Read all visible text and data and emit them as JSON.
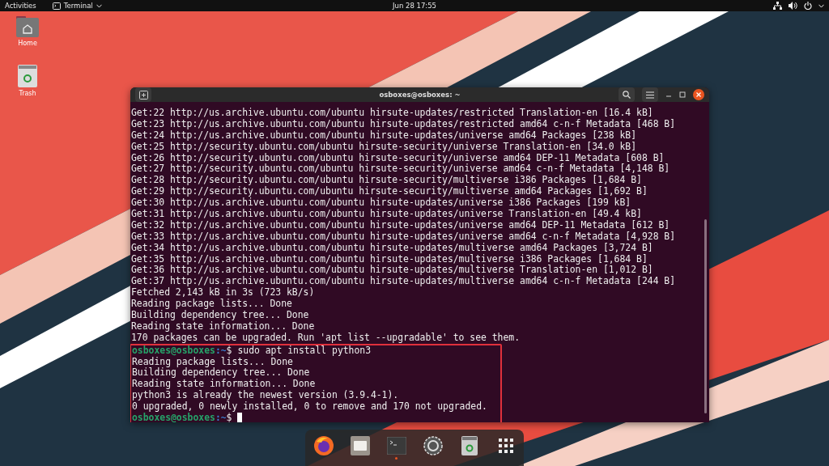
{
  "top_bar": {
    "activities": "Activities",
    "app_menu": "Terminal",
    "clock": "Jun 28  17:55"
  },
  "desktop_icons": [
    {
      "kind": "home",
      "label": "Home"
    },
    {
      "kind": "trash",
      "label": "Trash"
    }
  ],
  "terminal": {
    "title": "osboxes@osboxes: ~",
    "lines": [
      {
        "kind": "output",
        "text": "Get:22 http://us.archive.ubuntu.com/ubuntu hirsute-updates/restricted Translation-en [16.4 kB]"
      },
      {
        "kind": "output",
        "text": "Get:23 http://us.archive.ubuntu.com/ubuntu hirsute-updates/restricted amd64 c-n-f Metadata [468 B]"
      },
      {
        "kind": "output",
        "text": "Get:24 http://us.archive.ubuntu.com/ubuntu hirsute-updates/universe amd64 Packages [238 kB]"
      },
      {
        "kind": "output",
        "text": "Get:25 http://security.ubuntu.com/ubuntu hirsute-security/universe Translation-en [34.0 kB]"
      },
      {
        "kind": "output",
        "text": "Get:26 http://security.ubuntu.com/ubuntu hirsute-security/universe amd64 DEP-11 Metadata [608 B]"
      },
      {
        "kind": "output",
        "text": "Get:27 http://security.ubuntu.com/ubuntu hirsute-security/universe amd64 c-n-f Metadata [4,148 B]"
      },
      {
        "kind": "output",
        "text": "Get:28 http://security.ubuntu.com/ubuntu hirsute-security/multiverse i386 Packages [1,684 B]"
      },
      {
        "kind": "output",
        "text": "Get:29 http://security.ubuntu.com/ubuntu hirsute-security/multiverse amd64 Packages [1,692 B]"
      },
      {
        "kind": "output",
        "text": "Get:30 http://us.archive.ubuntu.com/ubuntu hirsute-updates/universe i386 Packages [199 kB]"
      },
      {
        "kind": "output",
        "text": "Get:31 http://us.archive.ubuntu.com/ubuntu hirsute-updates/universe Translation-en [49.4 kB]"
      },
      {
        "kind": "output",
        "text": "Get:32 http://us.archive.ubuntu.com/ubuntu hirsute-updates/universe amd64 DEP-11 Metadata [612 B]"
      },
      {
        "kind": "output",
        "text": "Get:33 http://us.archive.ubuntu.com/ubuntu hirsute-updates/universe amd64 c-n-f Metadata [4,928 B]"
      },
      {
        "kind": "output",
        "text": "Get:34 http://us.archive.ubuntu.com/ubuntu hirsute-updates/multiverse amd64 Packages [3,724 B]"
      },
      {
        "kind": "output",
        "text": "Get:35 http://us.archive.ubuntu.com/ubuntu hirsute-updates/multiverse i386 Packages [1,684 B]"
      },
      {
        "kind": "output",
        "text": "Get:36 http://us.archive.ubuntu.com/ubuntu hirsute-updates/multiverse Translation-en [1,012 B]"
      },
      {
        "kind": "output",
        "text": "Get:37 http://us.archive.ubuntu.com/ubuntu hirsute-updates/multiverse amd64 c-n-f Metadata [244 B]"
      },
      {
        "kind": "output",
        "text": "Fetched 2,143 kB in 3s (723 kB/s)"
      },
      {
        "kind": "output",
        "text": "Reading package lists... Done"
      },
      {
        "kind": "output",
        "text": "Building dependency tree... Done"
      },
      {
        "kind": "output",
        "text": "Reading state information... Done"
      },
      {
        "kind": "output",
        "text": "170 packages can be upgraded. Run 'apt list --upgradable' to see them."
      }
    ],
    "highlight": {
      "lines": [
        {
          "kind": "prompt",
          "user": "osboxes@osboxes",
          "path": ":~",
          "symbol": "$",
          "command": "sudo apt install python3"
        },
        {
          "kind": "output",
          "text": "Reading package lists... Done"
        },
        {
          "kind": "output",
          "text": "Building dependency tree... Done"
        },
        {
          "kind": "output",
          "text": "Reading state information... Done"
        },
        {
          "kind": "output",
          "text": "python3 is already the newest version (3.9.4-1)."
        },
        {
          "kind": "output",
          "text": "0 upgraded, 0 newly installed, 0 to remove and 170 not upgraded."
        },
        {
          "kind": "input",
          "user": "osboxes@osboxes",
          "path": ":~",
          "symbol": "$"
        }
      ]
    }
  },
  "dock": [
    {
      "kind": "browser",
      "running": false
    },
    {
      "kind": "files",
      "running": false
    },
    {
      "kind": "terminal",
      "running": true
    },
    {
      "kind": "settings",
      "running": false
    },
    {
      "kind": "trash",
      "running": false
    },
    {
      "kind": "apps",
      "running": false
    }
  ]
}
